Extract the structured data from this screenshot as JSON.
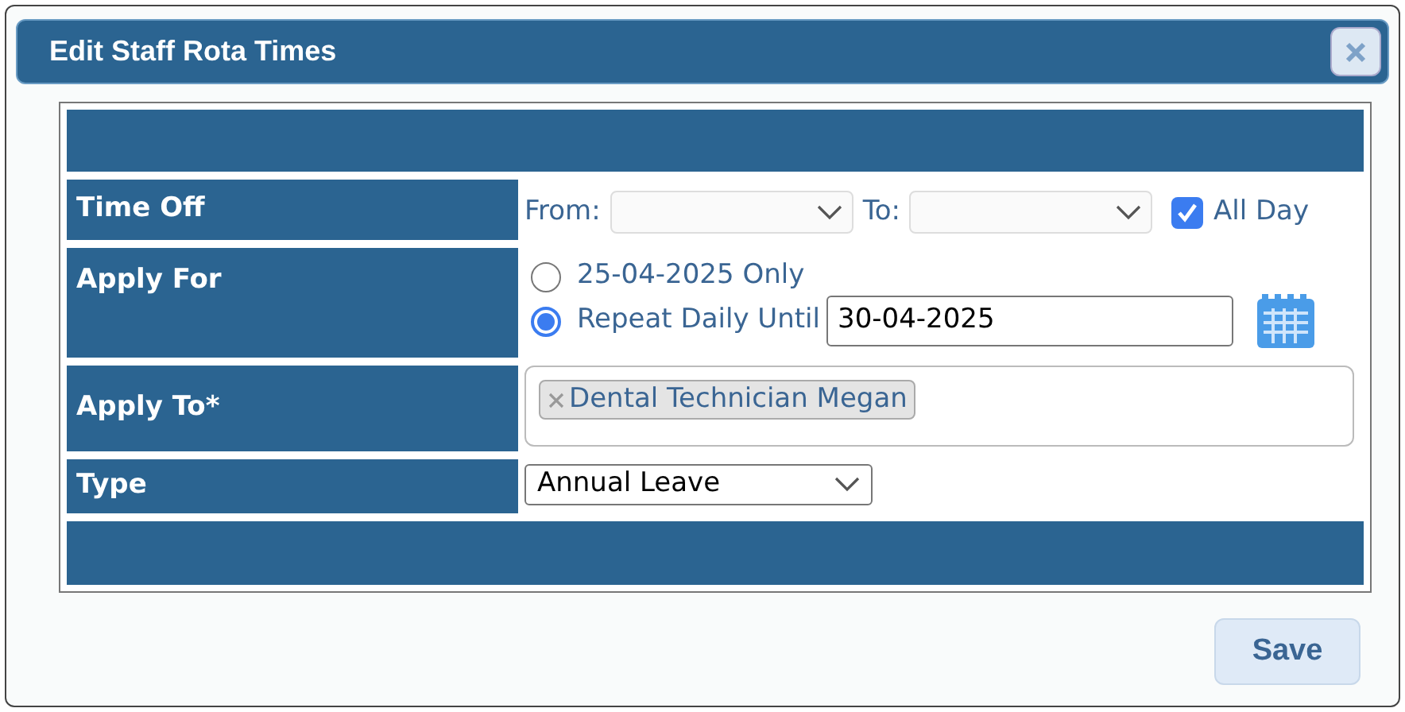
{
  "dialog": {
    "title": "Edit Staff Rota Times"
  },
  "form": {
    "time_off": {
      "label": "Time Off",
      "from_label": "From:",
      "to_label": "To:",
      "all_day": {
        "label": "All Day",
        "checked": true
      }
    },
    "apply_for": {
      "label": "Apply For",
      "options": [
        {
          "label": "25-04-2025 Only",
          "selected": false
        },
        {
          "label": "Repeat Daily Until",
          "selected": true
        }
      ],
      "until_value": "30-04-2025"
    },
    "apply_to": {
      "label": "Apply To*",
      "tags": [
        "Dental Technician Megan"
      ]
    },
    "type": {
      "label": "Type",
      "value": "Annual Leave"
    }
  },
  "buttons": [
    "Save"
  ]
}
